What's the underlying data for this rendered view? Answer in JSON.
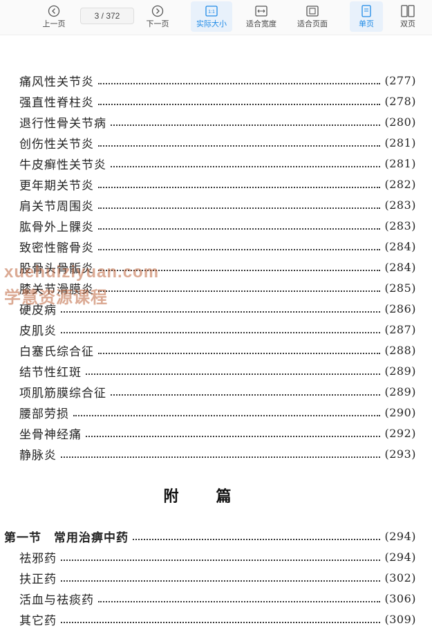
{
  "toolbar": {
    "prev_label": "上一页",
    "page_current": "3",
    "page_total": "/ 372",
    "next_label": "下一页",
    "actual_size_label": "实际大小",
    "fit_width_label": "适合宽度",
    "fit_page_label": "适合页面",
    "single_page_label": "单页",
    "double_page_label": "双页",
    "accent_color": "#1e8ae6"
  },
  "toc": {
    "entries": [
      {
        "title": "痛风性关节炎",
        "page": "(277)"
      },
      {
        "title": "强直性脊柱炎",
        "page": "(278)"
      },
      {
        "title": "退行性骨关节病",
        "page": "(280)"
      },
      {
        "title": "创伤性关节炎",
        "page": "(281)"
      },
      {
        "title": "牛皮癣性关节炎",
        "page": "(281)"
      },
      {
        "title": "更年期关节炎",
        "page": "(282)"
      },
      {
        "title": "肩关节周围炎",
        "page": "(283)"
      },
      {
        "title": "肱骨外上髁炎",
        "page": "(283)"
      },
      {
        "title": "致密性髂骨炎",
        "page": "(284)"
      },
      {
        "title": "股骨头骨骺炎",
        "page": "(284)"
      },
      {
        "title": "膝关节滑膜炎",
        "page": "(285)"
      },
      {
        "title": "硬皮病",
        "page": "(286)"
      },
      {
        "title": "皮肌炎",
        "page": "(287)"
      },
      {
        "title": "白塞氏综合征",
        "page": "(288)"
      },
      {
        "title": "结节性红斑",
        "page": "(289)"
      },
      {
        "title": "项肌筋膜综合征",
        "page": "(289)"
      },
      {
        "title": "腰部劳损",
        "page": "(290)"
      },
      {
        "title": "坐骨神经痛",
        "page": "(292)"
      },
      {
        "title": "静脉炎",
        "page": "(293)"
      }
    ],
    "appendix_heading": "附篇",
    "appendix_entries": [
      {
        "title": "第一节　常用治痹中药",
        "page": "(294)",
        "bold": true
      },
      {
        "title": "祛邪药",
        "page": "(294)"
      },
      {
        "title": "扶正药",
        "page": "(302)"
      },
      {
        "title": "活血与祛痰药",
        "page": "(306)"
      },
      {
        "title": "其它药",
        "page": "(309)"
      }
    ]
  },
  "watermark": {
    "line1": "xuehuiziyuan.com",
    "line2": "学慧资源课程"
  }
}
